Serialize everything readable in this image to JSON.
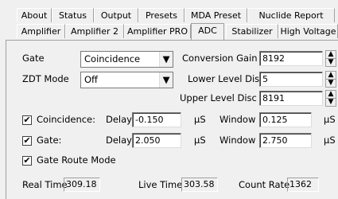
{
  "tabs_row1": [
    {
      "label": "About"
    },
    {
      "label": "Status"
    },
    {
      "label": "Output"
    },
    {
      "label": "Presets"
    },
    {
      "label": "MDA Preset"
    },
    {
      "label": "Nuclide Report"
    }
  ],
  "tabs_row2": [
    {
      "label": "Amplifier"
    },
    {
      "label": "Amplifier 2"
    },
    {
      "label": "Amplifier PRO"
    },
    {
      "label": "ADC",
      "active": true
    },
    {
      "label": "Stabilizer"
    },
    {
      "label": "High Voltage"
    }
  ],
  "adc": {
    "gate_label": "Gate",
    "gate_value": "Coincidence",
    "zdt_label": "ZDT Mode",
    "zdt_value": "Off",
    "conversion_gain_label": "Conversion Gain",
    "conversion_gain_value": "8192",
    "lld_label": "Lower Level Disc",
    "lld_value": "5",
    "uld_label": "Upper Level Disc",
    "uld_value": "8191",
    "coincidence_label": "Coincidence:",
    "coincidence_checked": true,
    "coincidence_delay_label": "Delay",
    "coincidence_delay_value": "-0.150",
    "coincidence_delay_unit": "µS",
    "coincidence_window_label": "Window",
    "coincidence_window_value": "0.125",
    "coincidence_window_unit": "µS",
    "gate_row_label": "Gate:",
    "gate_checked": true,
    "gate_delay_label": "Delay",
    "gate_delay_value": "2.050",
    "gate_delay_unit": "µS",
    "gate_window_label": "Window",
    "gate_window_value": "2.750",
    "gate_window_unit": "µS",
    "gate_route_label": "Gate Route Mode",
    "gate_route_checked": true
  },
  "status_bar": {
    "real_time_label": "Real Time",
    "real_time_value": "309.18",
    "live_time_label": "Live Time",
    "live_time_value": "303.58",
    "count_rate_label": "Count Rate",
    "count_rate_value": "1362"
  },
  "icons": {
    "check": "✔",
    "dropdown": "▼",
    "spin_up": "▲",
    "spin_down": "▼"
  }
}
